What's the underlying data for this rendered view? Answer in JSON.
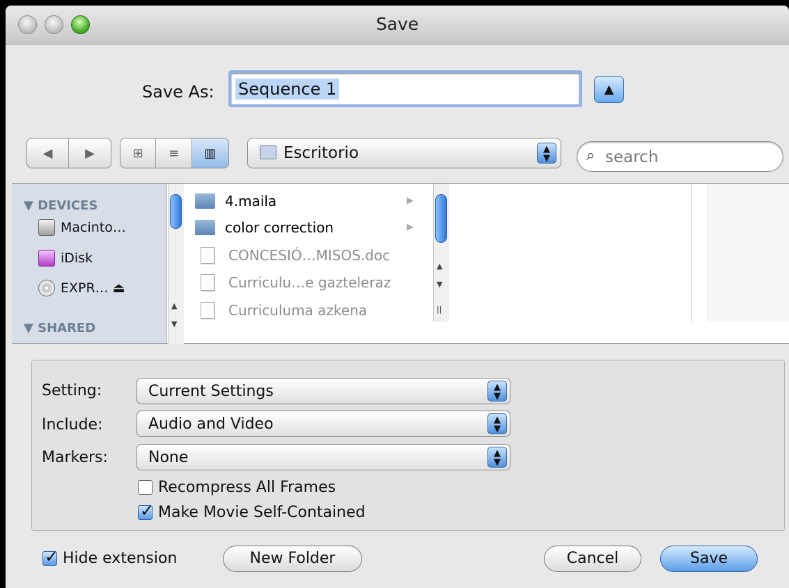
{
  "window": {
    "title": "Save"
  },
  "save_as": {
    "label": "Save As:",
    "value": "Sequence 1"
  },
  "toolbar": {
    "back_icon": "triangle-left-icon",
    "forward_icon": "triangle-right-icon",
    "view_icons": [
      "icon-view-icon",
      "list-view-icon",
      "column-view-icon"
    ],
    "location": "Escritorio",
    "search_placeholder": "search"
  },
  "sidebar": {
    "sections": [
      {
        "title": "▼ DEVICES",
        "items": [
          {
            "label": "Macinto…",
            "icon": "hard-drive-icon"
          },
          {
            "label": "iDisk",
            "icon": "idisk-icon"
          },
          {
            "label": "EXPR… ⏏",
            "icon": "dvd-icon"
          }
        ]
      },
      {
        "title": "▼ SHARED",
        "items": []
      }
    ]
  },
  "files": [
    {
      "name": "4.maila",
      "type": "folder",
      "dim": false
    },
    {
      "name": "color correction",
      "type": "folder",
      "dim": false
    },
    {
      "name": "CONCESIÓ…MISOS.doc",
      "type": "doc",
      "dim": true
    },
    {
      "name": "Curriculu…e gazteleraz",
      "type": "doc",
      "dim": true
    },
    {
      "name": "Curriculuma azkena",
      "type": "doc",
      "dim": true
    }
  ],
  "options": {
    "setting": {
      "label": "Setting:",
      "value": "Current Settings"
    },
    "include": {
      "label": "Include:",
      "value": "Audio and Video"
    },
    "markers": {
      "label": "Markers:",
      "value": "None"
    },
    "recompress": {
      "label": "Recompress All Frames",
      "checked": false
    },
    "self_contained": {
      "label": "Make Movie Self-Contained",
      "checked": true
    }
  },
  "bottom": {
    "hide_extension": {
      "label": "Hide extension",
      "checked": true
    },
    "new_folder": "New Folder",
    "cancel": "Cancel",
    "save": "Save"
  }
}
